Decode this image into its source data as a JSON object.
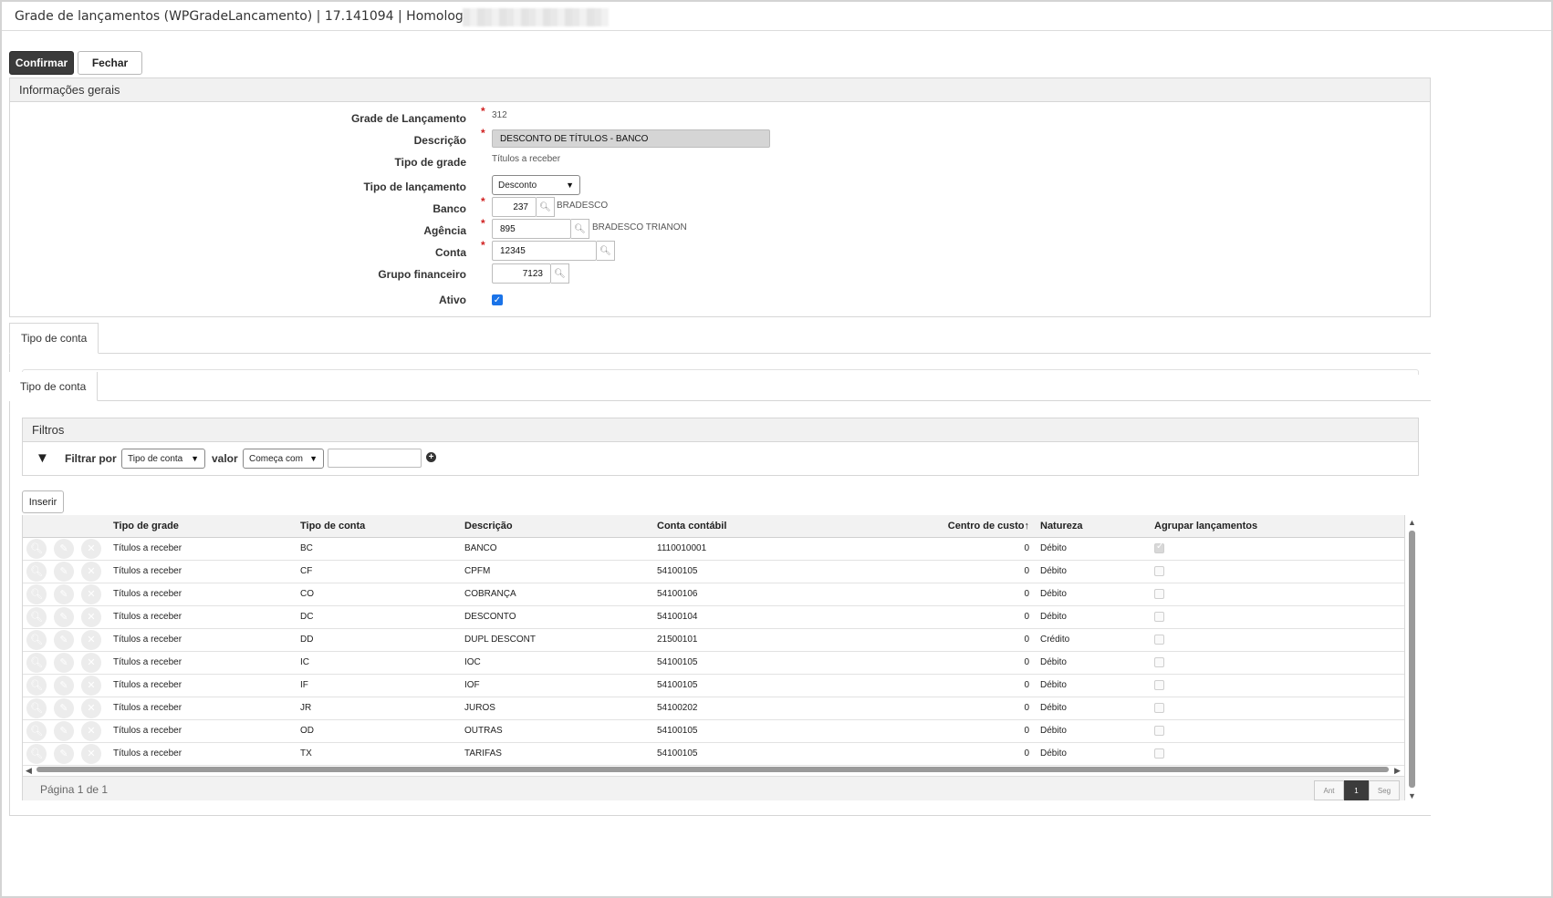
{
  "window": {
    "title": "Grade de lançamentos (WPGradeLancamento) | 17.141094 | Homologação |"
  },
  "toolbar": {
    "confirm_label": "Confirmar",
    "close_label": "Fechar"
  },
  "general_info": {
    "header": "Informações gerais",
    "fields": {
      "grade": {
        "label": "Grade de Lançamento",
        "value": "312"
      },
      "descricao": {
        "label": "Descrição",
        "value": "DESCONTO DE TÍTULOS - BANCO"
      },
      "tipo_grade": {
        "label": "Tipo de grade",
        "value": "Títulos a receber"
      },
      "tipo_lancamento": {
        "label": "Tipo de lançamento",
        "value": "Desconto"
      },
      "banco": {
        "label": "Banco",
        "value": "237",
        "desc": "BRADESCO"
      },
      "agencia": {
        "label": "Agência",
        "value": "895",
        "desc": "BRADESCO TRIANON"
      },
      "conta": {
        "label": "Conta",
        "value": "12345"
      },
      "grupo": {
        "label": "Grupo financeiro",
        "value": "7123"
      },
      "ativo": {
        "label": "Ativo",
        "checked": true
      }
    }
  },
  "tabs": {
    "outer": "Tipo de conta",
    "inner": "Tipo de conta"
  },
  "filters": {
    "header": "Filtros",
    "filter_by_label": "Filtrar por",
    "filter_by_value": "Tipo de conta",
    "value_label": "valor",
    "operator_value": "Começa com",
    "text_value": ""
  },
  "insert_label": "Inserir",
  "table": {
    "columns": [
      "Tipo de grade",
      "Tipo de conta",
      "Descrição",
      "Conta contábil",
      "Centro de custo",
      "Natureza",
      "Agrupar lançamentos"
    ],
    "rows": [
      {
        "tipo_grade": "Títulos a receber",
        "tipo_conta": "BC",
        "descricao": "BANCO",
        "conta": "1110010001",
        "centro": "0",
        "natureza": "Débito",
        "agrupar": true
      },
      {
        "tipo_grade": "Títulos a receber",
        "tipo_conta": "CF",
        "descricao": "CPFM",
        "conta": "54100105",
        "centro": "0",
        "natureza": "Débito",
        "agrupar": false
      },
      {
        "tipo_grade": "Títulos a receber",
        "tipo_conta": "CO",
        "descricao": "COBRANÇA",
        "conta": "54100106",
        "centro": "0",
        "natureza": "Débito",
        "agrupar": false
      },
      {
        "tipo_grade": "Títulos a receber",
        "tipo_conta": "DC",
        "descricao": "DESCONTO",
        "conta": "54100104",
        "centro": "0",
        "natureza": "Débito",
        "agrupar": false
      },
      {
        "tipo_grade": "Títulos a receber",
        "tipo_conta": "DD",
        "descricao": "DUPL DESCONT",
        "conta": "21500101",
        "centro": "0",
        "natureza": "Crédito",
        "agrupar": false
      },
      {
        "tipo_grade": "Títulos a receber",
        "tipo_conta": "IC",
        "descricao": "IOC",
        "conta": "54100105",
        "centro": "0",
        "natureza": "Débito",
        "agrupar": false
      },
      {
        "tipo_grade": "Títulos a receber",
        "tipo_conta": "IF",
        "descricao": "IOF",
        "conta": "54100105",
        "centro": "0",
        "natureza": "Débito",
        "agrupar": false
      },
      {
        "tipo_grade": "Títulos a receber",
        "tipo_conta": "JR",
        "descricao": "JUROS",
        "conta": "54100202",
        "centro": "0",
        "natureza": "Débito",
        "agrupar": false
      },
      {
        "tipo_grade": "Títulos a receber",
        "tipo_conta": "OD",
        "descricao": "OUTRAS",
        "conta": "54100105",
        "centro": "0",
        "natureza": "Débito",
        "agrupar": false
      },
      {
        "tipo_grade": "Títulos a receber",
        "tipo_conta": "TX",
        "descricao": "TARIFAS",
        "conta": "54100105",
        "centro": "0",
        "natureza": "Débito",
        "agrupar": false
      }
    ]
  },
  "pager": {
    "info": "Página 1 de 1",
    "prev": "Ant",
    "current": "1",
    "next": "Seg"
  },
  "colors": {
    "primary_button": "#3b3b3b",
    "checkbox_accent": "#1a73e8",
    "required": "#d02020"
  }
}
